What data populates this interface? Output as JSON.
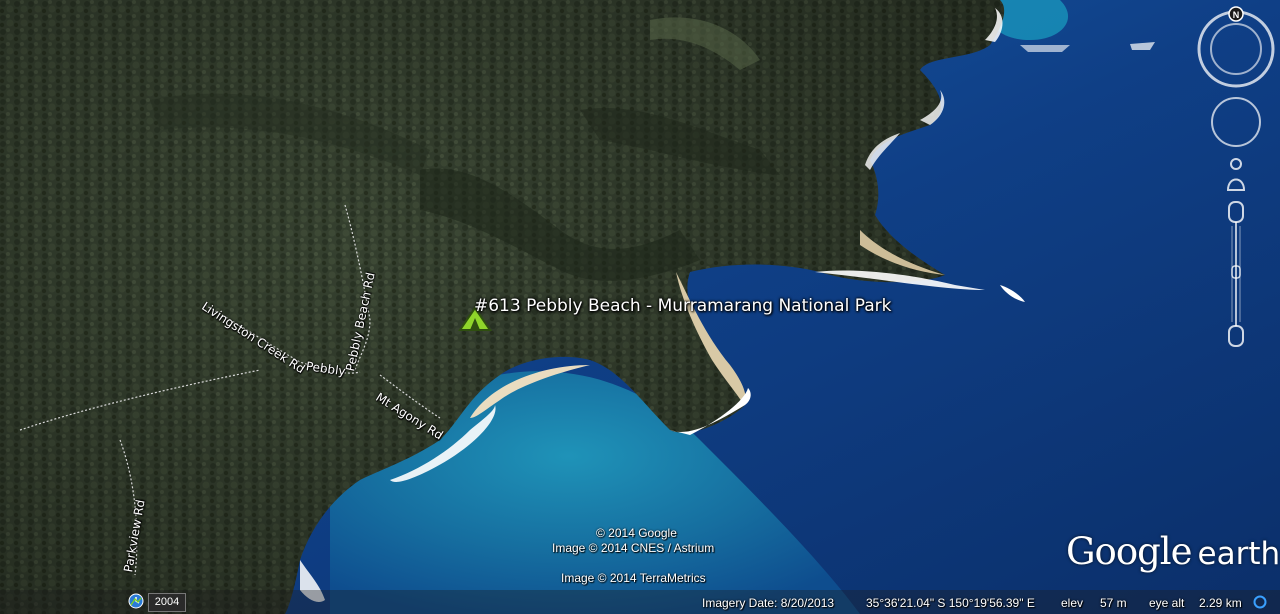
{
  "app": {
    "brand_main": "Google",
    "brand_sub": "earth"
  },
  "placemark": {
    "label": "#613 Pebbly Beach - Murramarang National Park",
    "icon": "campground-icon",
    "color": "#7ed321"
  },
  "roads": [
    {
      "id": "livingston",
      "label": "Livingston Creek Rd"
    },
    {
      "id": "pebbly-beach-vertical",
      "label": "Pebbly Beach Rd"
    },
    {
      "id": "pebbly-horizontal",
      "label": "Pebbly"
    },
    {
      "id": "mt-agony",
      "label": "Mt Agony Rd"
    },
    {
      "id": "parkview",
      "label": "Parkview Rd"
    }
  ],
  "credits": {
    "line1": "© 2014 Google",
    "line2": "Image © 2014 CNES / Astrium",
    "line3": "Image © 2014 TerraMetrics"
  },
  "status": {
    "history_year": "2004",
    "imagery_date": "Imagery Date: 8/20/2013",
    "coordinates": "35°36'21.04\" S  150°19'56.39\" E",
    "elev_label": "elev",
    "elev_value": "57 m",
    "eye_alt_label": "eye alt",
    "eye_alt_value": "2.29 km"
  },
  "navigation": {
    "north_label": "N",
    "controls": [
      "compass-ring-icon",
      "look-joystick-icon",
      "street-view-pegman-icon",
      "zoom-slider-icon"
    ]
  },
  "colors": {
    "forest": "#2f3a2a",
    "ocean_deep": "#0f3f82",
    "ocean_shallow": "#1a7fa8",
    "surf": "#ffffff",
    "sand": "#e9dcc0"
  }
}
